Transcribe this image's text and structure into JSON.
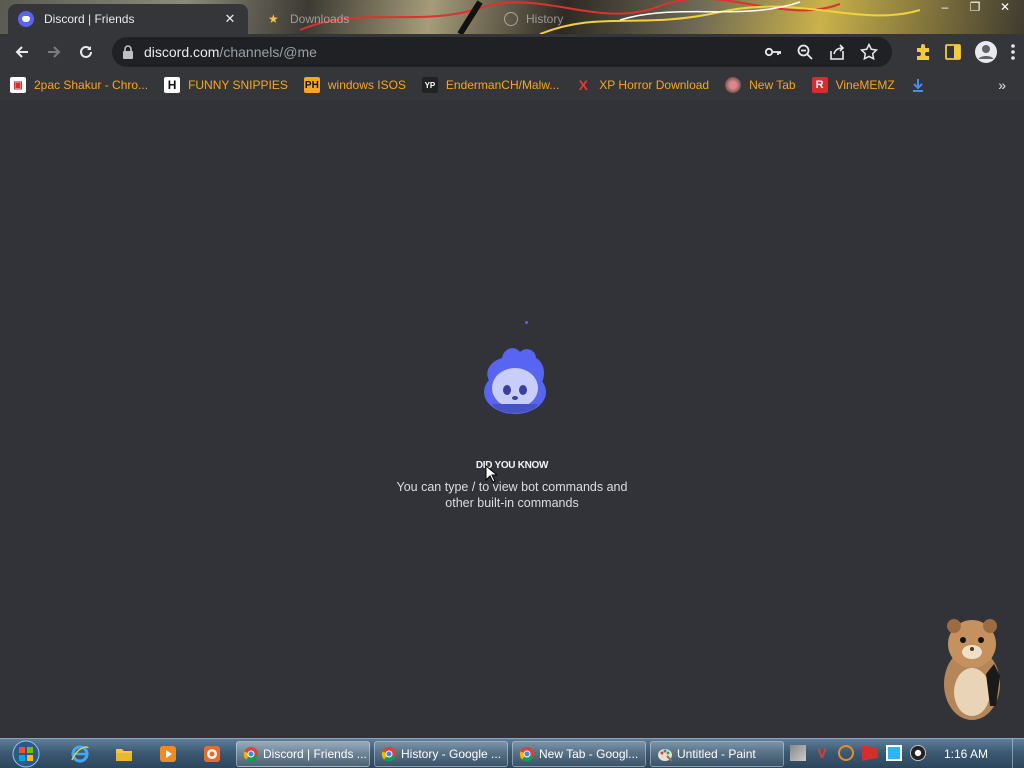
{
  "browser": {
    "tabs": [
      {
        "title": "Discord | Friends",
        "active": true
      },
      {
        "title": "Downloads",
        "active": false
      },
      {
        "title": "History",
        "active": false
      }
    ],
    "url_domain": "discord.com",
    "url_path": "/channels/@me",
    "window_controls": [
      "–",
      "❐",
      "✕"
    ]
  },
  "bookmarks": [
    {
      "label": "2pac Shakur - Chro...",
      "icon": "gift-icon"
    },
    {
      "label": "FUNNY SNIPPIES",
      "icon": "h-icon"
    },
    {
      "label": "windows ISOS",
      "icon": "ph-icon"
    },
    {
      "label": "EndermanCH/Malw...",
      "icon": "yp-icon"
    },
    {
      "label": "XP Horror Download",
      "icon": "x-icon"
    },
    {
      "label": "New Tab",
      "icon": "globe-icon"
    },
    {
      "label": "VineMEMZ",
      "icon": "r-icon"
    }
  ],
  "bookmarks_more": "»",
  "loading": {
    "title": "DID YOU KNOW",
    "text": "You can type / to view bot commands and other built-in commands"
  },
  "taskbar": {
    "tasks": [
      {
        "label": "Discord | Friends ...",
        "icon": "chrome-icon"
      },
      {
        "label": "History - Google ...",
        "icon": "chrome-icon"
      },
      {
        "label": "New Tab - Googl...",
        "icon": "chrome-icon"
      },
      {
        "label": "Untitled - Paint",
        "icon": "paint-icon"
      }
    ],
    "clock": "1:16 AM"
  },
  "colors": {
    "discord_bg": "#313338",
    "blurple": "#5865f2",
    "bookmark_text": "#f5a623",
    "chrome_toolbar": "#35363a"
  }
}
